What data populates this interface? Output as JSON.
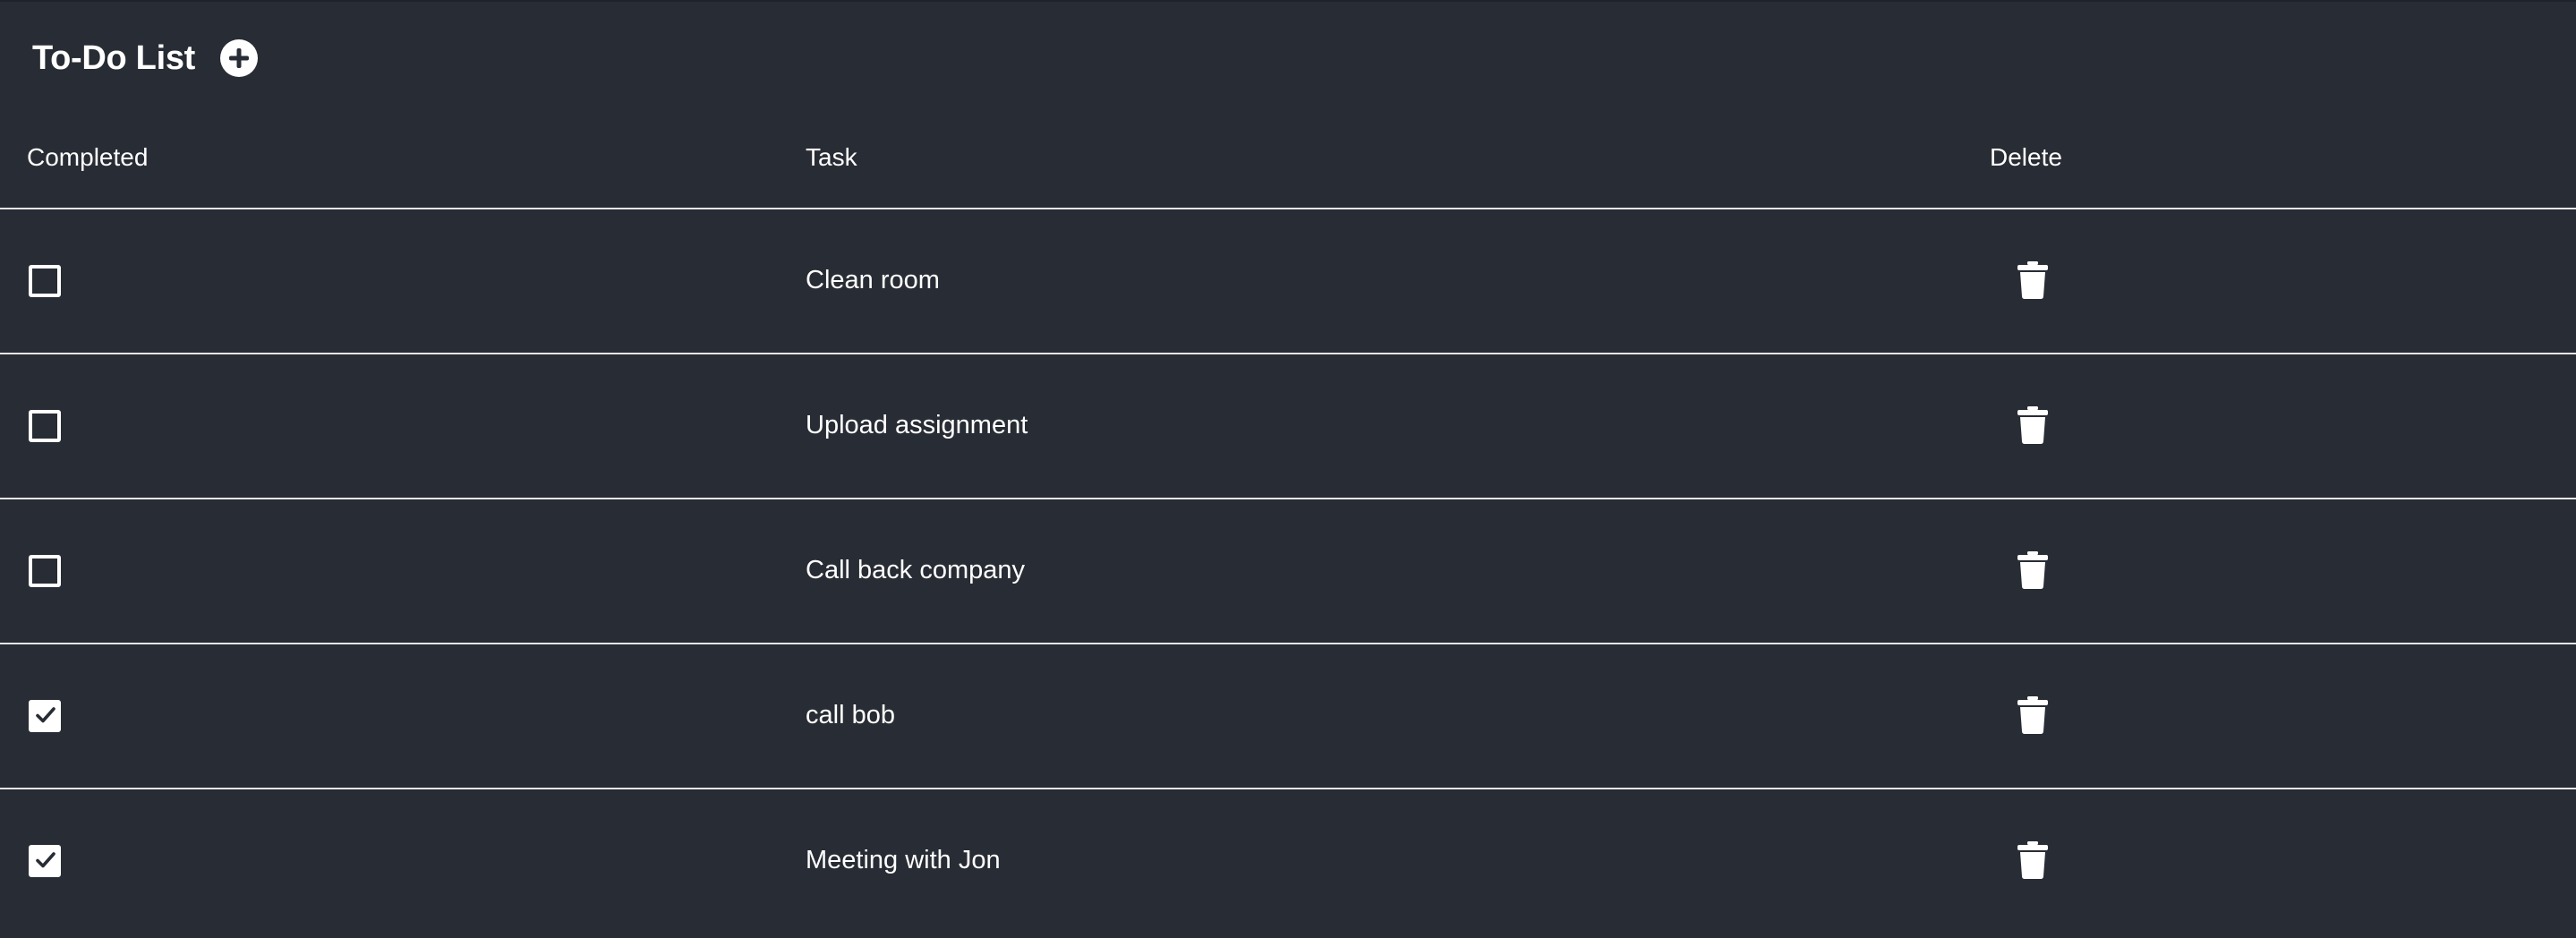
{
  "app": {
    "title": "To-Do List",
    "add_icon": "plus-circle-icon"
  },
  "table": {
    "headers": {
      "completed": "Completed",
      "task": "Task",
      "delete": "Delete"
    },
    "rows": [
      {
        "completed": false,
        "task": "Clean room",
        "delete_icon": "trash-icon"
      },
      {
        "completed": false,
        "task": "Upload assignment",
        "delete_icon": "trash-icon"
      },
      {
        "completed": false,
        "task": "Call back company",
        "delete_icon": "trash-icon"
      },
      {
        "completed": true,
        "task": "call bob",
        "delete_icon": "trash-icon"
      },
      {
        "completed": true,
        "task": "Meeting with Jon",
        "delete_icon": "trash-icon"
      }
    ]
  },
  "colors": {
    "background": "#282c34",
    "text": "#ffffff",
    "divider": "#e6e6e6"
  }
}
